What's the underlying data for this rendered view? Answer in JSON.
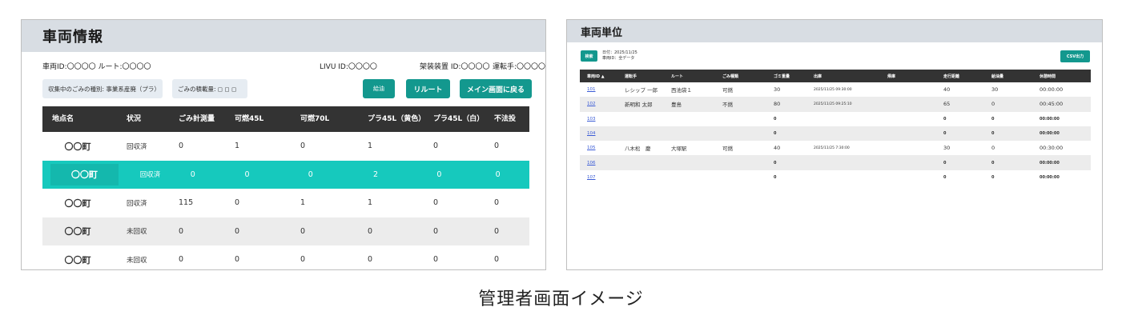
{
  "left": {
    "title": "車両情報",
    "info": {
      "vehicle_route": "車両ID:〇〇〇〇 ルート:〇〇〇〇",
      "livu": "LIVU ID:〇〇〇〇",
      "device": "架装装置 ID:〇〇〇〇",
      "driver": "運転手:〇〇〇〇"
    },
    "filters": {
      "waste_type": "収集中のごみの種別: 事業系産廃（プラ）",
      "weight": "ごみの積載量: ◻ ◻ ◻"
    },
    "buttons": {
      "refuel": "給油",
      "reroute": "リルート",
      "back_main": "メイン画面に戻る"
    },
    "table": {
      "headers": [
        "地点名",
        "状況",
        "ごみ計測量",
        "可燃45L",
        "可燃70L",
        "プラ45L（黄色）",
        "プラ45L（白）",
        "不法投"
      ],
      "rows": [
        [
          "〇〇町",
          "回収済",
          "0",
          "1",
          "0",
          "1",
          "0",
          "0"
        ],
        [
          "〇〇町",
          "回収済",
          "0",
          "0",
          "0",
          "2",
          "0",
          "0"
        ],
        [
          "〇〇町",
          "回収済",
          "115",
          "0",
          "1",
          "1",
          "0",
          "0"
        ],
        [
          "〇〇町",
          "未回収",
          "0",
          "0",
          "0",
          "0",
          "0",
          "0"
        ],
        [
          "〇〇町",
          "未回収",
          "0",
          "0",
          "0",
          "0",
          "0",
          "0"
        ]
      ],
      "highlighted_row": 1
    }
  },
  "right": {
    "title": "車両単位",
    "search_label": "検索",
    "date_label": "日付：2025/11/25",
    "vehicle_label": "車両ID：全データ",
    "csv_label": "CSV出力",
    "table": {
      "headers": [
        "車両ID ▲",
        "運転手",
        "ルート",
        "ごみ種類",
        "ゴミ重量",
        "出庫",
        "帰庫",
        "走行距離",
        "給油量",
        "休憩時間"
      ],
      "rows": [
        [
          "101",
          "レシップ 一郎",
          "西池袋１",
          "可燃",
          "30",
          "2025/11/25 09:30:00",
          "",
          "40",
          "30",
          "00:00:00"
        ],
        [
          "102",
          "新明和 太郎",
          "豊島",
          "不燃",
          "80",
          "2025/11/25 09:25:10",
          "",
          "65",
          "0",
          "00:45:00"
        ],
        [
          "103",
          "",
          "",
          "",
          "0",
          "",
          "",
          "0",
          "0",
          "00:00:00"
        ],
        [
          "104",
          "",
          "",
          "",
          "0",
          "",
          "",
          "0",
          "0",
          "00:00:00"
        ],
        [
          "105",
          "八木松　慶",
          "大塚駅",
          "可燃",
          "40",
          "2025/11/25 7:30:00",
          "",
          "30",
          "0",
          "00:30:00"
        ],
        [
          "106",
          "",
          "",
          "",
          "0",
          "",
          "",
          "0",
          "0",
          "00:00:00"
        ],
        [
          "107",
          "",
          "",
          "",
          "0",
          "",
          "",
          "0",
          "0",
          "00:00:00"
        ]
      ]
    }
  },
  "caption": "管理者画面イメージ",
  "colors": {
    "accent_teal": "#13988e",
    "highlight_row": "#16c9bd",
    "header_dark": "#333333",
    "title_bar": "#d8dde3",
    "link": "#3a5bd6"
  }
}
